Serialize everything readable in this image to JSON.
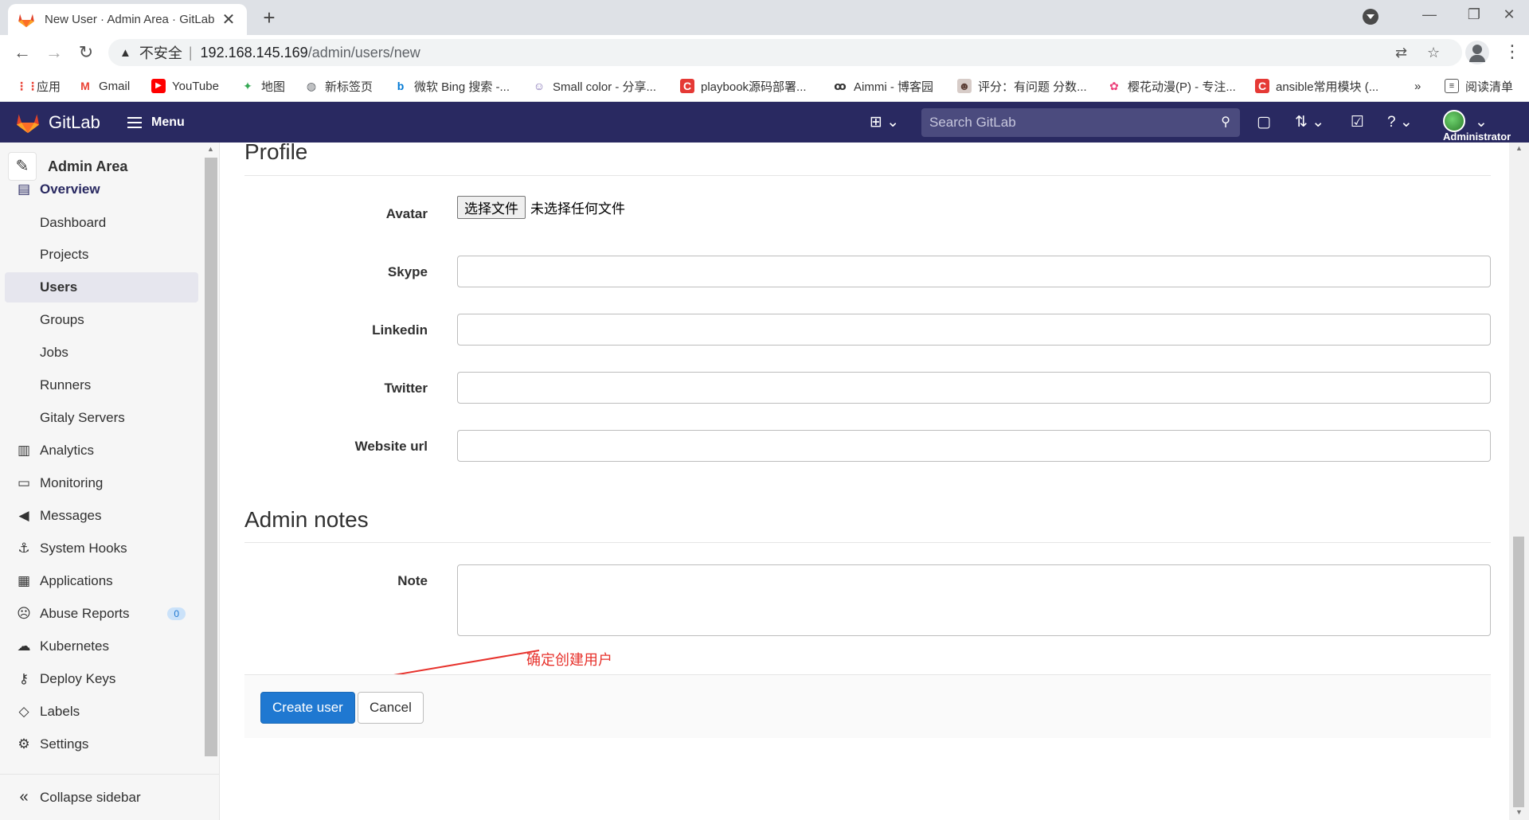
{
  "browser": {
    "tab_title": "New User · Admin Area · GitLab",
    "new_tab_glyph": "+",
    "close_glyph": "✕",
    "insecure_label": "不安全",
    "url_host": "192.168.145.169",
    "url_path": "/admin/users/new",
    "bookmarks": [
      {
        "label": "应用",
        "icon": "apps-grid-icon",
        "color": "#e94235"
      },
      {
        "label": "Gmail",
        "icon": "gmail-icon",
        "color": "#ea4335"
      },
      {
        "label": "YouTube",
        "icon": "youtube-icon",
        "color": "#ff0000"
      },
      {
        "label": "地图",
        "icon": "maps-icon",
        "color": "#34a853"
      },
      {
        "label": "新标签页",
        "icon": "globe-icon",
        "color": "#5f6368"
      },
      {
        "label": "微软 Bing 搜索 -...",
        "icon": "bing-icon",
        "color": "#0078d4"
      },
      {
        "label": "Small color - 分享...",
        "icon": "site-icon",
        "color": "#7c6bb0"
      },
      {
        "label": "playbook源码部署...",
        "icon": "csdn-icon",
        "color": "#e53935"
      },
      {
        "label": "Aimmi - 博客园",
        "icon": "blog-icon",
        "color": "#333333"
      },
      {
        "label": "评分：有问题 分数...",
        "icon": "avatar-icon",
        "color": "#8d6e63"
      },
      {
        "label": "樱花动漫(P) - 专注...",
        "icon": "flower-icon",
        "color": "#ec407a"
      },
      {
        "label": "ansible常用模块 (...",
        "icon": "csdn-icon",
        "color": "#e53935"
      }
    ],
    "more_bookmarks": "»",
    "reading_list": "阅读清单"
  },
  "gitlab_header": {
    "brand": "GitLab",
    "menu_label": "Menu",
    "search_placeholder": "Search GitLab",
    "user_label": "Administrator"
  },
  "sidebar": {
    "context_title": "Admin Area",
    "items": [
      {
        "label": "Overview",
        "icon": "overview-icon"
      },
      {
        "label": "Dashboard"
      },
      {
        "label": "Projects"
      },
      {
        "label": "Users"
      },
      {
        "label": "Groups"
      },
      {
        "label": "Jobs"
      },
      {
        "label": "Runners"
      },
      {
        "label": "Gitaly Servers"
      },
      {
        "label": "Analytics",
        "icon": "analytics-icon"
      },
      {
        "label": "Monitoring",
        "icon": "monitor-icon"
      },
      {
        "label": "Messages",
        "icon": "megaphone-icon"
      },
      {
        "label": "System Hooks",
        "icon": "hook-icon"
      },
      {
        "label": "Applications",
        "icon": "applications-icon"
      },
      {
        "label": "Abuse Reports",
        "icon": "abuse-icon",
        "badge": "0"
      },
      {
        "label": "Kubernetes",
        "icon": "kubernetes-icon"
      },
      {
        "label": "Deploy Keys",
        "icon": "key-icon"
      },
      {
        "label": "Labels",
        "icon": "label-icon"
      },
      {
        "label": "Settings",
        "icon": "gear-icon"
      }
    ],
    "collapse_label": "Collapse sidebar"
  },
  "form": {
    "profile_title": "Profile",
    "avatar_label": "Avatar",
    "file_button": "选择文件",
    "file_none": "未选择任何文件",
    "skype_label": "Skype",
    "skype_value": "",
    "linkedin_label": "Linkedin",
    "linkedin_value": "",
    "twitter_label": "Twitter",
    "twitter_value": "",
    "website_label": "Website url",
    "website_value": "",
    "admin_notes_title": "Admin notes",
    "note_label": "Note",
    "note_value": "",
    "create_button": "Create user",
    "cancel_button": "Cancel"
  },
  "annotation": {
    "text": "确定创建用户",
    "color": "#e7322c"
  }
}
